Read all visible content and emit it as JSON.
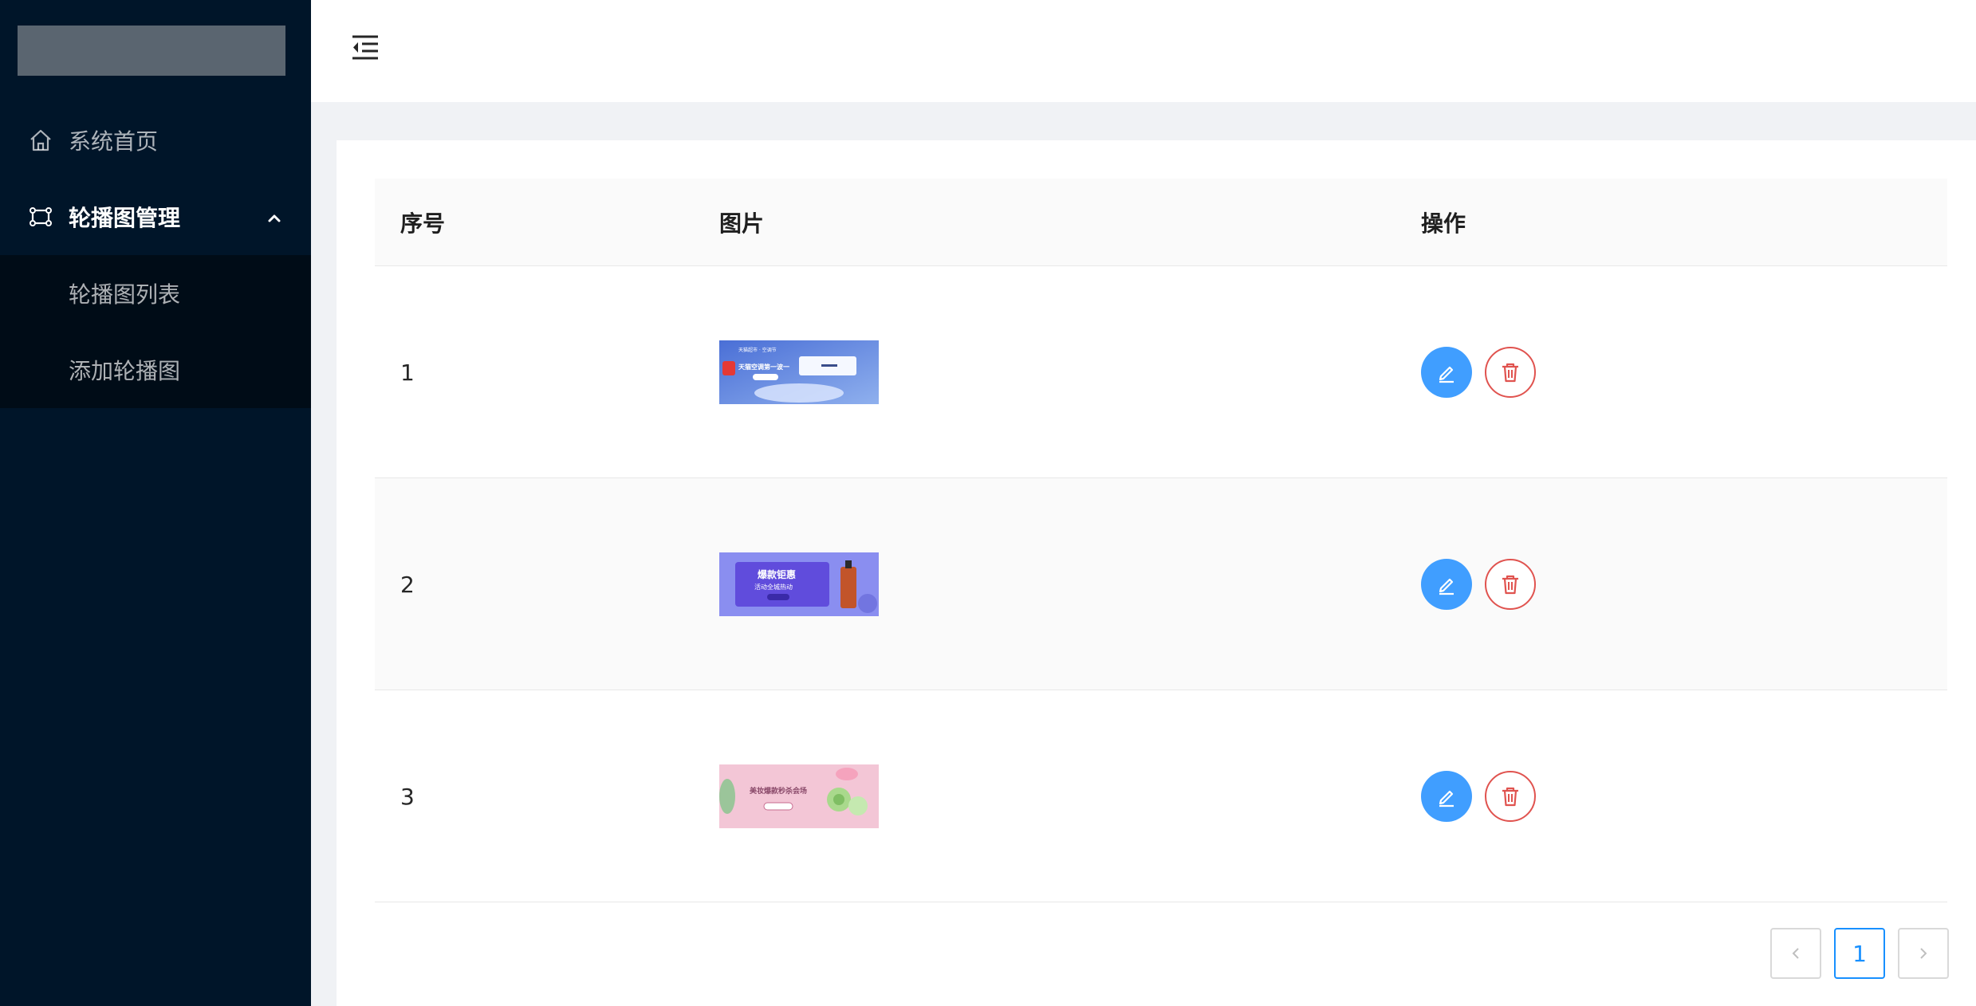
{
  "sidebar": {
    "menu": [
      {
        "label": "系统首页",
        "icon": "home-icon"
      },
      {
        "label": "轮播图管理",
        "icon": "carousel-icon"
      }
    ],
    "submenu": [
      {
        "label": "轮播图列表"
      },
      {
        "label": "添加轮播图"
      }
    ]
  },
  "table": {
    "headers": [
      "序号",
      "图片",
      "操作"
    ],
    "rows": [
      {
        "index": "1",
        "image_text": "天猫空调第一波一"
      },
      {
        "index": "2",
        "image_text": "爆款钜惠",
        "image_sub": "活动全城热动"
      },
      {
        "index": "3",
        "image_text": "美妆爆款秒杀会场"
      }
    ]
  },
  "pagination": {
    "prev": "<",
    "current": "1",
    "next": ">"
  },
  "colors": {
    "sidebar_bg": "#001529",
    "submenu_bg": "#000c17",
    "primary": "#409eff",
    "danger": "#e0534f",
    "active_page": "#1890ff"
  }
}
